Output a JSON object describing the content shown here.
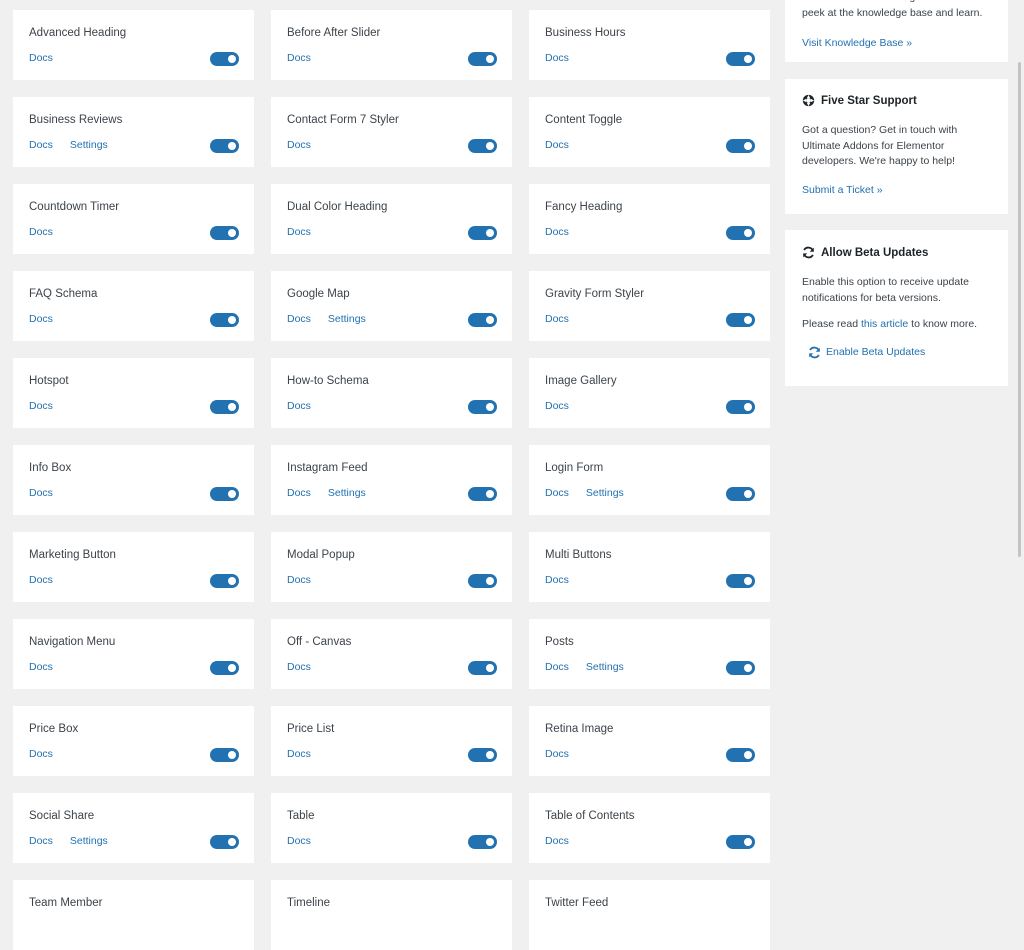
{
  "widgets": [
    {
      "name": "Advanced Heading",
      "docs": "Docs",
      "settings": ""
    },
    {
      "name": "Before After Slider",
      "docs": "Docs",
      "settings": ""
    },
    {
      "name": "Business Hours",
      "docs": "Docs",
      "settings": ""
    },
    {
      "name": "Business Reviews",
      "docs": "Docs",
      "settings": "Settings"
    },
    {
      "name": "Contact Form 7 Styler",
      "docs": "Docs",
      "settings": ""
    },
    {
      "name": "Content Toggle",
      "docs": "Docs",
      "settings": ""
    },
    {
      "name": "Countdown Timer",
      "docs": "Docs",
      "settings": ""
    },
    {
      "name": "Dual Color Heading",
      "docs": "Docs",
      "settings": ""
    },
    {
      "name": "Fancy Heading",
      "docs": "Docs",
      "settings": ""
    },
    {
      "name": "FAQ Schema",
      "docs": "Docs",
      "settings": ""
    },
    {
      "name": "Google Map",
      "docs": "Docs",
      "settings": "Settings"
    },
    {
      "name": "Gravity Form Styler",
      "docs": "Docs",
      "settings": ""
    },
    {
      "name": "Hotspot",
      "docs": "Docs",
      "settings": ""
    },
    {
      "name": "How-to Schema",
      "docs": "Docs",
      "settings": ""
    },
    {
      "name": "Image Gallery",
      "docs": "Docs",
      "settings": ""
    },
    {
      "name": "Info Box",
      "docs": "Docs",
      "settings": ""
    },
    {
      "name": "Instagram Feed",
      "docs": "Docs",
      "settings": "Settings"
    },
    {
      "name": "Login Form",
      "docs": "Docs",
      "settings": "Settings"
    },
    {
      "name": "Marketing Button",
      "docs": "Docs",
      "settings": ""
    },
    {
      "name": "Modal Popup",
      "docs": "Docs",
      "settings": ""
    },
    {
      "name": "Multi Buttons",
      "docs": "Docs",
      "settings": ""
    },
    {
      "name": "Navigation Menu",
      "docs": "Docs",
      "settings": ""
    },
    {
      "name": "Off - Canvas",
      "docs": "Docs",
      "settings": ""
    },
    {
      "name": "Posts",
      "docs": "Docs",
      "settings": "Settings"
    },
    {
      "name": "Price Box",
      "docs": "Docs",
      "settings": ""
    },
    {
      "name": "Price List",
      "docs": "Docs",
      "settings": ""
    },
    {
      "name": "Retina Image",
      "docs": "Docs",
      "settings": ""
    },
    {
      "name": "Social Share",
      "docs": "Docs",
      "settings": "Settings"
    },
    {
      "name": "Table",
      "docs": "Docs",
      "settings": ""
    },
    {
      "name": "Table of Contents",
      "docs": "Docs",
      "settings": ""
    },
    {
      "name": "Team Member",
      "docs": "",
      "settings": ""
    },
    {
      "name": "Timeline",
      "docs": "",
      "settings": ""
    },
    {
      "name": "Twitter Feed",
      "docs": "",
      "settings": ""
    }
  ],
  "sidebar": {
    "knowledge": {
      "text": "Not sure how something works? Take a peek at the knowledge base and learn.",
      "link": "Visit Knowledge Base »"
    },
    "support": {
      "title": "Five Star Support",
      "text": "Got a question? Get in touch with Ultimate Addons for Elementor developers. We're happy to help!",
      "link": "Submit a Ticket »"
    },
    "beta": {
      "title": "Allow Beta Updates",
      "text": "Enable this option to receive update notifications for beta versions.",
      "read_prefix": "Please read ",
      "read_link": "this article",
      "read_suffix": " to know more.",
      "button": "Enable Beta Updates"
    }
  },
  "colors": {
    "accent": "#2271b1",
    "background": "#f0f0f1",
    "card": "#ffffff"
  }
}
